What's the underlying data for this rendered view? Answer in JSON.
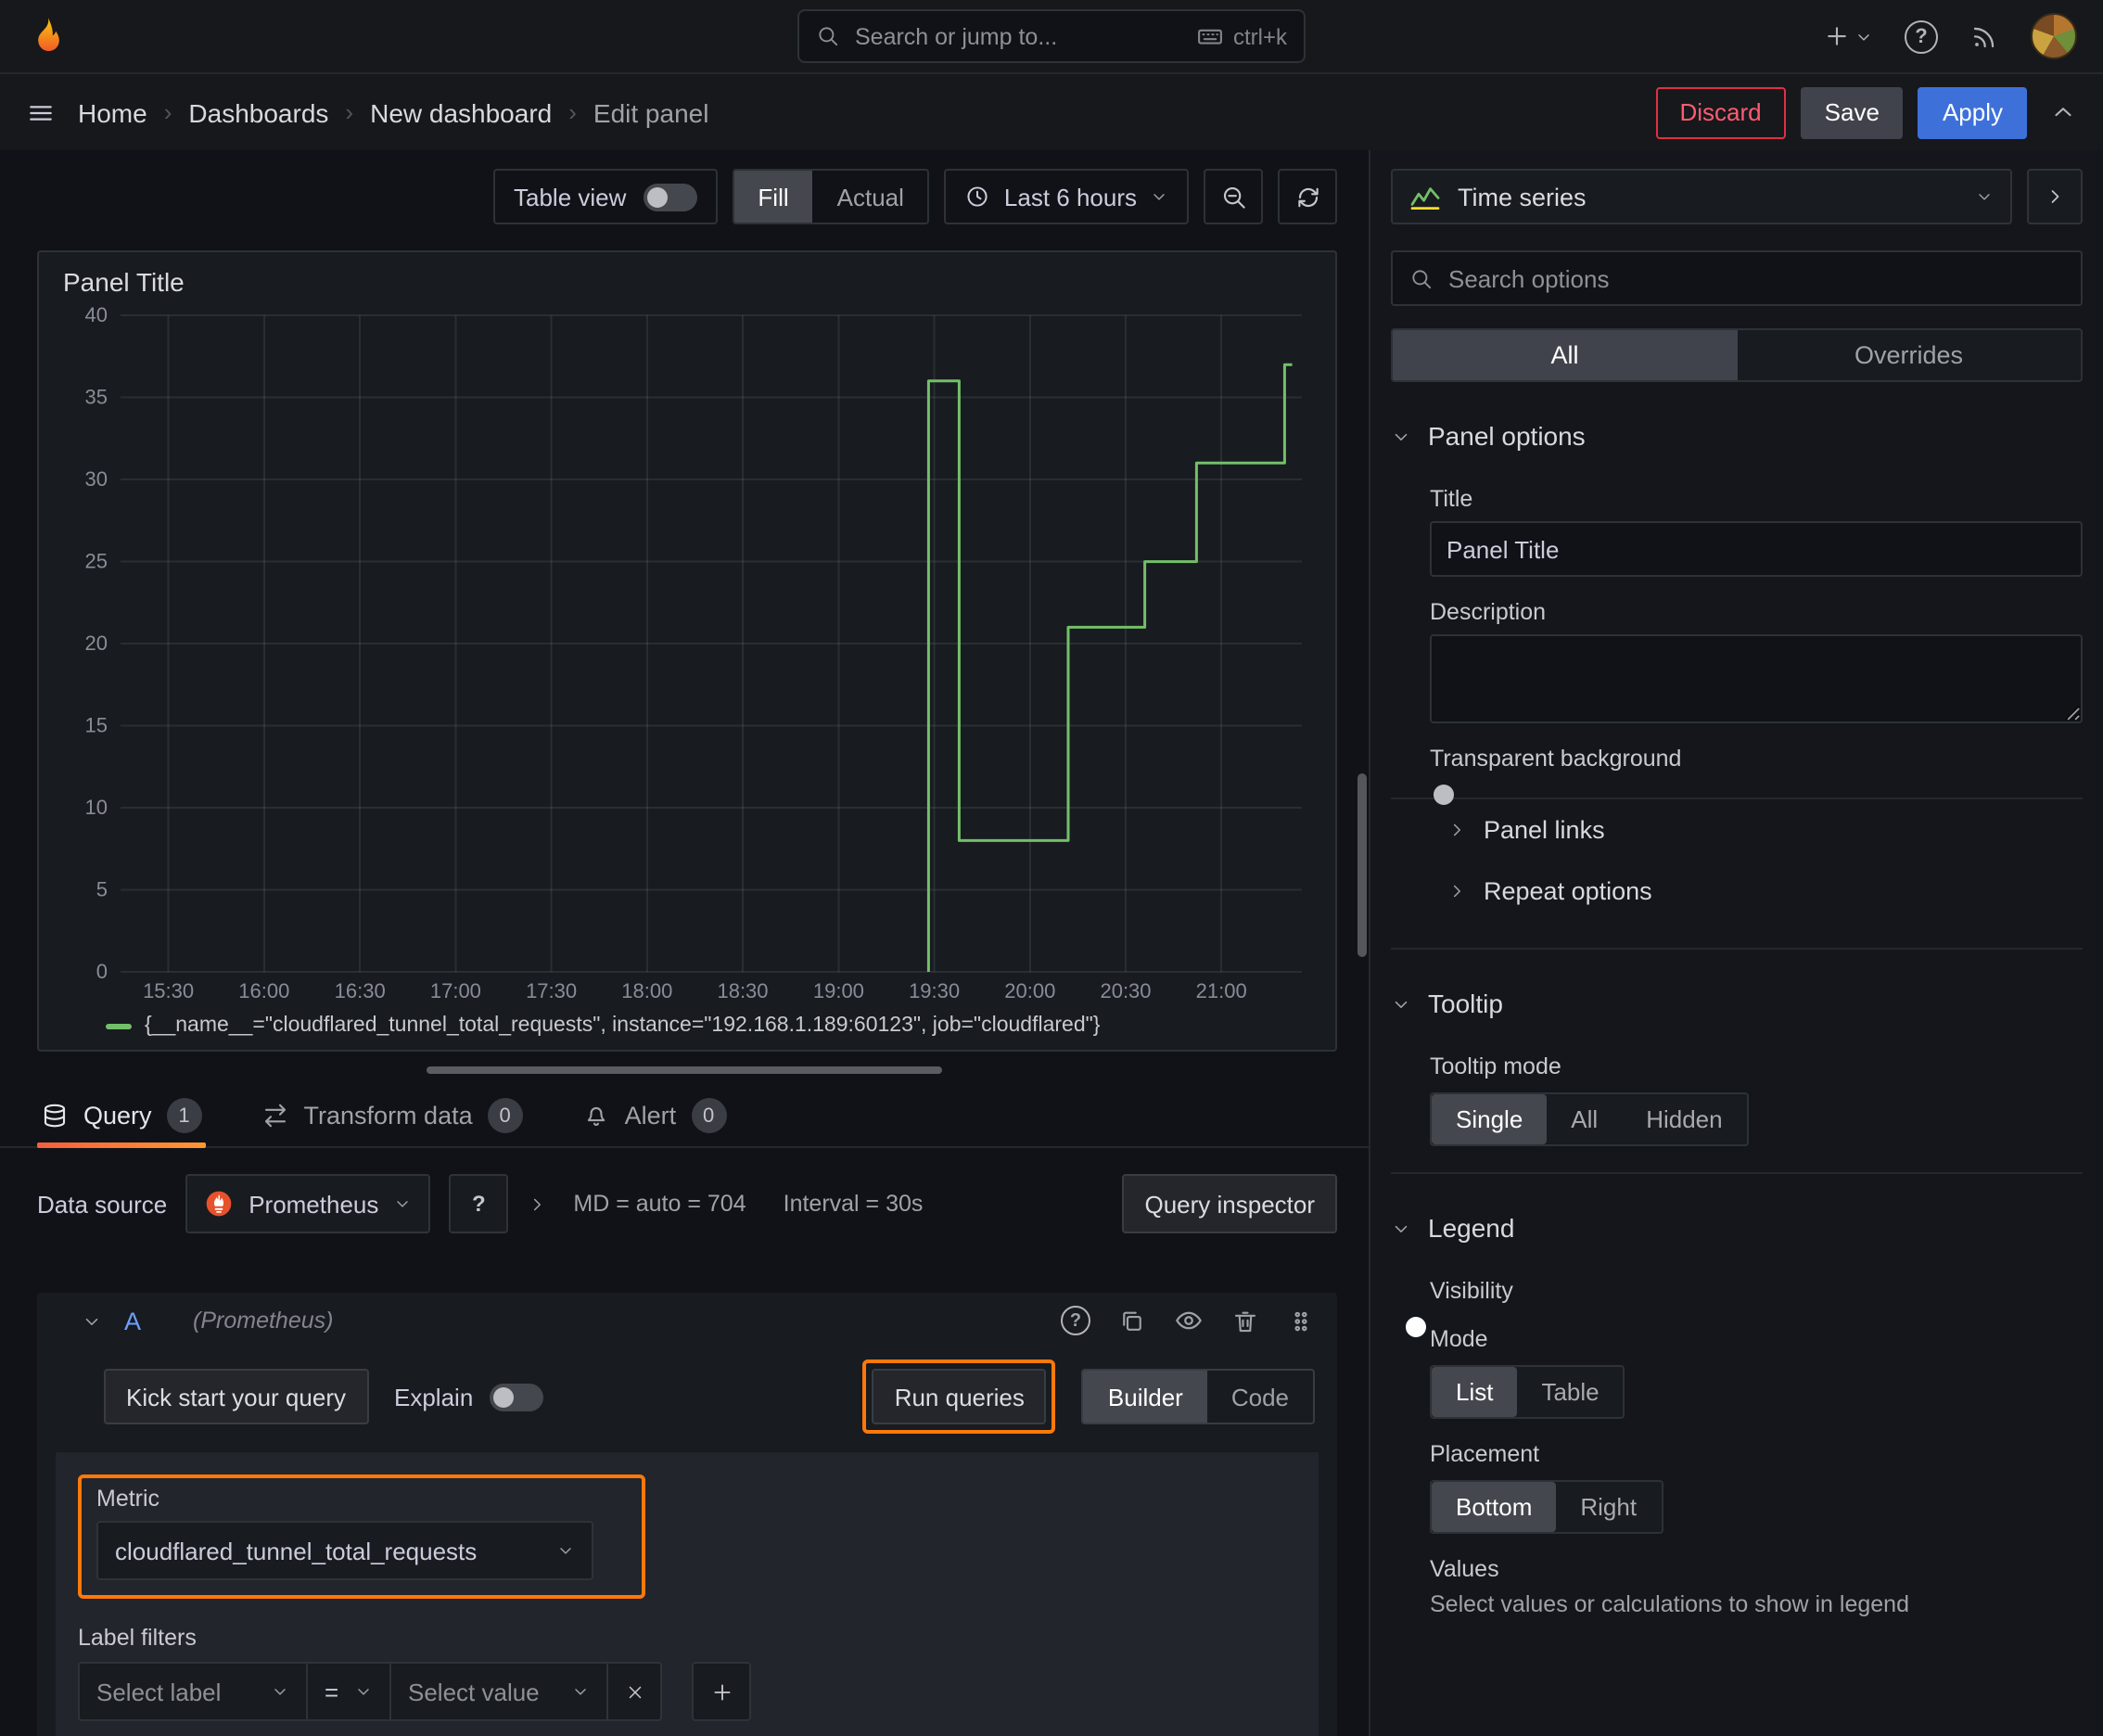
{
  "topnav": {
    "search_placeholder": "Search or jump to...",
    "search_shortcut": "ctrl+k"
  },
  "breadcrumb": {
    "items": [
      "Home",
      "Dashboards",
      "New dashboard",
      "Edit panel"
    ],
    "actions": {
      "discard": "Discard",
      "save": "Save",
      "apply": "Apply"
    }
  },
  "toolbar": {
    "table_view_label": "Table view",
    "fill_label": "Fill",
    "actual_label": "Actual",
    "time_range_label": "Last 6 hours"
  },
  "panel": {
    "title": "Panel Title"
  },
  "chart_data": {
    "type": "line",
    "title": "Panel Title",
    "xlabel": "",
    "ylabel": "",
    "xlim": [
      15.25,
      21.42
    ],
    "ylim": [
      0,
      40
    ],
    "grid": true,
    "legend_position": "bottom",
    "x_ticks": [
      "15:30",
      "16:00",
      "16:30",
      "17:00",
      "17:30",
      "18:00",
      "18:30",
      "19:00",
      "19:30",
      "20:00",
      "20:30",
      "21:00"
    ],
    "x_tick_hours": [
      15.5,
      16,
      16.5,
      17,
      17.5,
      18,
      18.5,
      19,
      19.5,
      20,
      20.5,
      21
    ],
    "y_ticks": [
      0,
      5,
      10,
      15,
      20,
      25,
      30,
      35,
      40
    ],
    "series": [
      {
        "name": "{__name__=\"cloudflared_tunnel_total_requests\", instance=\"192.168.1.189:60123\", job=\"cloudflared\"}",
        "color": "#73BF69",
        "points": [
          [
            19.47,
            0
          ],
          [
            19.47,
            36
          ],
          [
            19.63,
            36
          ],
          [
            19.63,
            8
          ],
          [
            20.2,
            8
          ],
          [
            20.2,
            21
          ],
          [
            20.6,
            21
          ],
          [
            20.6,
            25
          ],
          [
            20.87,
            25
          ],
          [
            20.87,
            31
          ],
          [
            21.33,
            31
          ],
          [
            21.33,
            37
          ],
          [
            21.37,
            37
          ]
        ]
      }
    ]
  },
  "tabs": {
    "query_label": "Query",
    "query_count": "1",
    "transform_label": "Transform data",
    "transform_count": "0",
    "alert_label": "Alert",
    "alert_count": "0"
  },
  "query": {
    "datasource_label": "Data source",
    "datasource_value": "Prometheus",
    "max_datapoints": "MD = auto = 704",
    "interval": "Interval = 30s",
    "query_inspector_label": "Query inspector",
    "ref_id": "A",
    "ref_type": "(Prometheus)",
    "kick_start_label": "Kick start your query",
    "explain_label": "Explain",
    "run_queries_label": "Run queries",
    "builder_label": "Builder",
    "code_label": "Code",
    "metric_label": "Metric",
    "metric_value": "cloudflared_tunnel_total_requests",
    "label_filters_label": "Label filters",
    "select_label_placeholder": "Select label",
    "operator_value": "=",
    "select_value_placeholder": "Select value"
  },
  "options": {
    "viz_type": "Time series",
    "search_placeholder": "Search options",
    "tab_all": "All",
    "tab_overrides": "Overrides",
    "panel_options_title": "Panel options",
    "title_label": "Title",
    "title_value": "Panel Title",
    "description_label": "Description",
    "transparent_label": "Transparent background",
    "panel_links_label": "Panel links",
    "repeat_options_label": "Repeat options",
    "tooltip_title": "Tooltip",
    "tooltip_mode_label": "Tooltip mode",
    "tooltip_modes": [
      "Single",
      "All",
      "Hidden"
    ],
    "legend_title": "Legend",
    "visibility_label": "Visibility",
    "mode_label": "Mode",
    "mode_options": [
      "List",
      "Table"
    ],
    "placement_label": "Placement",
    "placement_options": [
      "Bottom",
      "Right"
    ],
    "values_label": "Values",
    "values_description": "Select values or calculations to show in legend"
  },
  "colors": {
    "accent_blue": "#3d71d9",
    "series_green": "#73BF69",
    "annotation_orange": "#ff780a",
    "discard_red": "#e02f44"
  }
}
